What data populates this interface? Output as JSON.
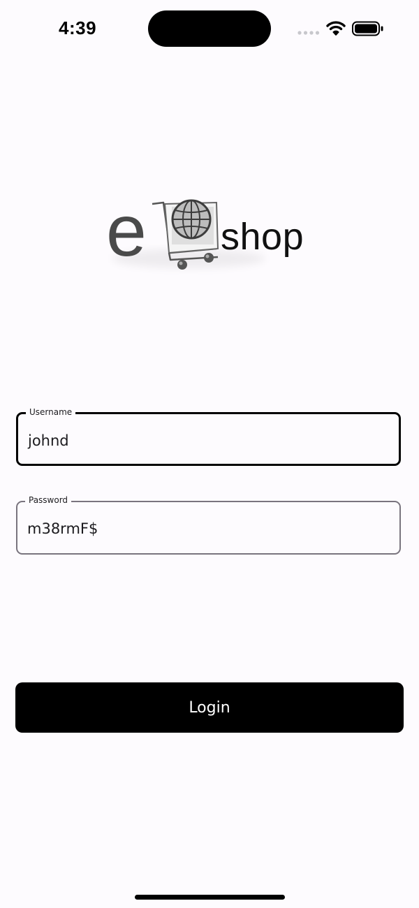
{
  "status_bar": {
    "time": "4:39",
    "icons": [
      "cellular-signal-icon",
      "wifi-icon",
      "battery-icon"
    ]
  },
  "logo": {
    "letter": "e",
    "word": "shop",
    "icon": "shopping-cart-globe-icon"
  },
  "form": {
    "username": {
      "label": "Username",
      "value": "johnd",
      "focused": true
    },
    "password": {
      "label": "Password",
      "value": "m38rmF$",
      "focused": false
    }
  },
  "login_button": {
    "label": "Login",
    "color": "#000000"
  },
  "colors": {
    "background": "#fdfbfe",
    "focused_border": "#000000",
    "idle_border": "#79747e"
  }
}
